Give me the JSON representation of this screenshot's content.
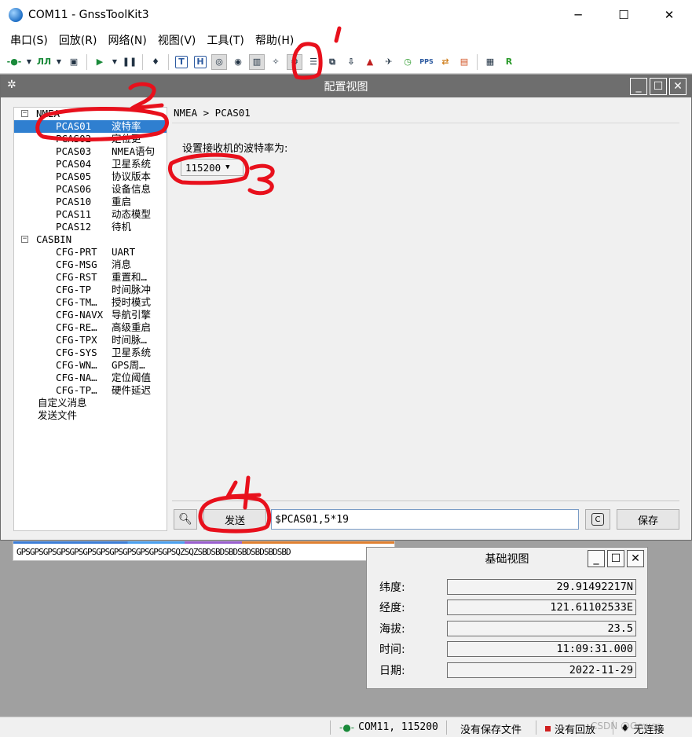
{
  "window": {
    "title": "COM11 - GnssToolKit3",
    "minimize": "─",
    "maximize": "☐",
    "close": "✕"
  },
  "menu": [
    "串口(S)",
    "回放(R)",
    "网络(N)",
    "视图(V)",
    "工具(T)",
    "帮助(H)"
  ],
  "config": {
    "title": "配置视图",
    "tree": {
      "nmea": {
        "label": "NMEA",
        "items": [
          {
            "code": "PCAS01",
            "desc": "波特率"
          },
          {
            "code": "PCAS02",
            "desc": "定位更"
          },
          {
            "code": "PCAS03",
            "desc": "NMEA语句"
          },
          {
            "code": "PCAS04",
            "desc": "卫星系统"
          },
          {
            "code": "PCAS05",
            "desc": "协议版本"
          },
          {
            "code": "PCAS06",
            "desc": "设备信息"
          },
          {
            "code": "PCAS10",
            "desc": "重启"
          },
          {
            "code": "PCAS11",
            "desc": "动态模型"
          },
          {
            "code": "PCAS12",
            "desc": "待机"
          }
        ]
      },
      "casbin": {
        "label": "CASBIN",
        "items": [
          {
            "code": "CFG-PRT",
            "desc": "UART"
          },
          {
            "code": "CFG-MSG",
            "desc": "消息"
          },
          {
            "code": "CFG-RST",
            "desc": "重置和…"
          },
          {
            "code": "CFG-TP",
            "desc": "时间脉冲"
          },
          {
            "code": "CFG-TM…",
            "desc": "授时模式"
          },
          {
            "code": "CFG-NAVX",
            "desc": "导航引擎"
          },
          {
            "code": "CFG-RE…",
            "desc": "高级重启"
          },
          {
            "code": "CFG-TPX",
            "desc": "时间脉…"
          },
          {
            "code": "CFG-SYS",
            "desc": "卫星系统"
          },
          {
            "code": "CFG-WN…",
            "desc": "GPS周…"
          },
          {
            "code": "CFG-NA…",
            "desc": "定位阈值"
          },
          {
            "code": "CFG-TP…",
            "desc": "硬件延迟"
          }
        ]
      },
      "custom": "自定义消息",
      "sendfile": "发送文件"
    },
    "breadcrumb": "NMEA > PCAS01",
    "set_label": "设置接收机的波特率为:",
    "baud_value": "115200",
    "send_label": "发送",
    "command": "$PCAS01,5*19",
    "save_label": "保存",
    "copy_label": "C"
  },
  "strip_text": "GPSGPSGPSGPSGPSGPSGPSGPSGPSGPSGPSGPSQZSQZSBDSBDSBDSBDSBDSBDSBD",
  "basic": {
    "title": "基础视图",
    "rows": [
      {
        "label": "纬度:",
        "value": "29.91492217N"
      },
      {
        "label": "经度:",
        "value": "121.61102533E"
      },
      {
        "label": "海拔:",
        "value": "23.5"
      },
      {
        "label": "时间:",
        "value": "11:09:31.000"
      },
      {
        "label": "日期:",
        "value": "2022-11-29"
      }
    ]
  },
  "status": {
    "port": "COM11, 115200",
    "save": "没有保存文件",
    "replay": "没有回放",
    "conn": "无连接",
    "watermark": "CSDN @Gowes"
  },
  "colors": {
    "annotation": "#e8101c",
    "selection": "#2f7fd0",
    "titlebar_dark": "#6e6e6e"
  },
  "annotations": [
    "1",
    "2",
    "3",
    "4"
  ]
}
